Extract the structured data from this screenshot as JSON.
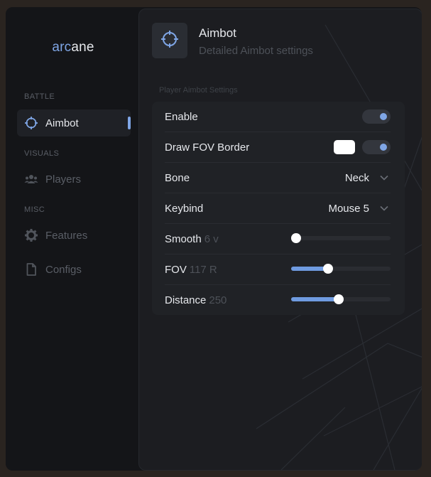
{
  "brand": {
    "accent_part": "arc",
    "rest_part": "ane"
  },
  "sidebar": {
    "sections": [
      {
        "label": "BATTLE",
        "items": [
          {
            "label": "Aimbot",
            "icon": "crosshair-icon",
            "active": true
          }
        ]
      },
      {
        "label": "VISUALS",
        "items": [
          {
            "label": "Players",
            "icon": "users-icon",
            "active": false
          }
        ]
      },
      {
        "label": "MISC",
        "items": [
          {
            "label": "Features",
            "icon": "gear-icon",
            "active": false
          },
          {
            "label": "Configs",
            "icon": "file-icon",
            "active": false
          }
        ]
      }
    ]
  },
  "header": {
    "title": "Aimbot",
    "subtitle": "Detailed Aimbot settings",
    "icon": "crosshair-icon"
  },
  "group": {
    "label": "Player Aimbot Settings"
  },
  "settings": {
    "enable": {
      "label": "Enable",
      "checked": true
    },
    "draw_fov_border": {
      "label": "Draw FOV Border",
      "checked": true,
      "color": "#ffffff"
    },
    "bone": {
      "label": "Bone",
      "value": "Neck"
    },
    "keybind": {
      "label": "Keybind",
      "value": "Mouse 5"
    },
    "smooth": {
      "label": "Smooth",
      "value_text": "6 v",
      "fraction": 0.05
    },
    "fov": {
      "label": "FOV",
      "value_text": "117 R",
      "fraction": 0.37
    },
    "distance": {
      "label": "Distance",
      "value_text": "250",
      "fraction": 0.48
    }
  },
  "colors": {
    "accent": "#7fa6e6",
    "background": "#141518",
    "panel": "#202226"
  }
}
